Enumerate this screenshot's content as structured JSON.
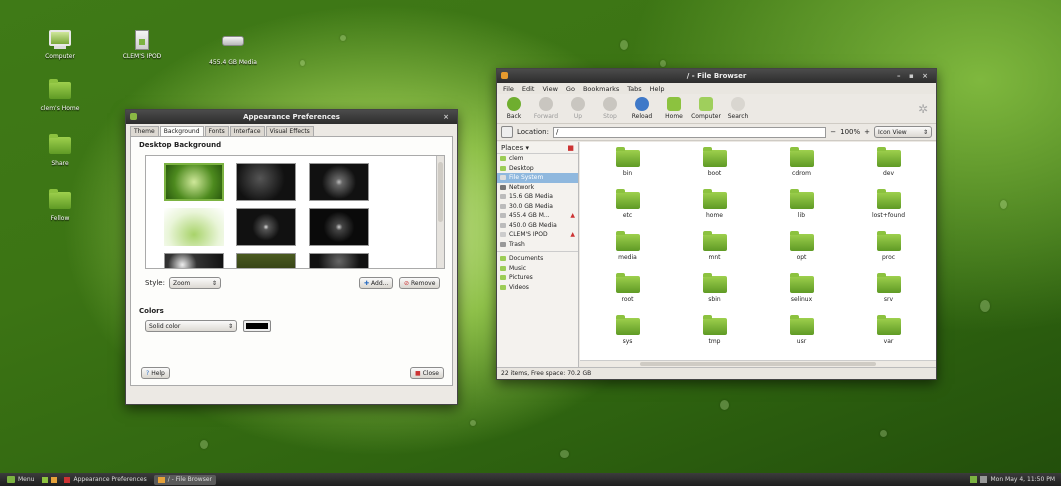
{
  "desktop_icons": [
    {
      "label": "Computer",
      "icon": "computer-icon"
    },
    {
      "label": "CLEM'S IPOD",
      "icon": "usb-drive-icon"
    },
    {
      "label": "455.4 GB Media",
      "icon": "hard-drive-icon"
    },
    {
      "label": "clem's Home",
      "icon": "home-folder-icon"
    },
    {
      "label": "Share",
      "icon": "folder-icon"
    },
    {
      "label": "Fellow",
      "icon": "folder-icon"
    }
  ],
  "appearance": {
    "title": "Appearance Preferences",
    "tabs": [
      "Theme",
      "Background",
      "Fonts",
      "Interface",
      "Visual Effects"
    ],
    "active_tab": "Background",
    "section_title": "Desktop Background",
    "style_label": "Style:",
    "style_value": "Zoom",
    "add_label": "Add...",
    "remove_label": "Remove",
    "colors_title": "Colors",
    "color_mode": "Solid color",
    "swatch_color": "#000000",
    "help_label": "Help",
    "close_label": "Close"
  },
  "browser": {
    "title": "/ - File Browser",
    "menu": [
      "File",
      "Edit",
      "View",
      "Go",
      "Bookmarks",
      "Tabs",
      "Help"
    ],
    "toolbar": [
      "Back",
      "Forward",
      "Up",
      "Stop",
      "Reload",
      "Home",
      "Computer",
      "Search"
    ],
    "location_label": "Location:",
    "location_value": "/",
    "zoom": "100%",
    "view_mode": "Icon View",
    "places_label": "Places",
    "places": [
      "clem",
      "Desktop",
      "File System",
      "Network",
      "15.6 GB Media",
      "30.0 GB Media",
      "455.4 GB M...",
      "450.0 GB Media",
      "CLEM'S IPOD",
      "Trash",
      "Documents",
      "Music",
      "Pictures",
      "Videos"
    ],
    "selected_place": "File System",
    "folders": [
      "bin",
      "boot",
      "cdrom",
      "dev",
      "etc",
      "home",
      "lib",
      "lost+found",
      "media",
      "mnt",
      "opt",
      "proc",
      "root",
      "sbin",
      "selinux",
      "srv",
      "sys",
      "tmp",
      "usr",
      "var"
    ],
    "status": "22 items, Free space: 70.2 GB"
  },
  "taskbar": {
    "menu_label": "Menu",
    "tasks": [
      "Appearance Preferences",
      "/ - File Browser"
    ],
    "clock": "Mon May 4, 11:50 PM"
  },
  "colors": {
    "accent": "#7cb342",
    "selection": "#8fb8de"
  }
}
